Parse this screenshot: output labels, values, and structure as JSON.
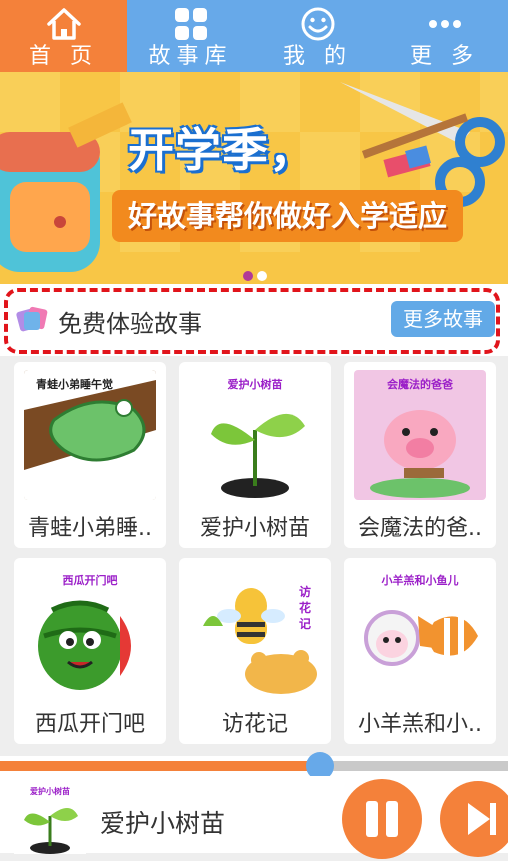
{
  "nav": {
    "items": [
      {
        "label": "首 页",
        "icon": "home-icon",
        "active": true
      },
      {
        "label": "故事库",
        "icon": "grid-icon",
        "active": false
      },
      {
        "label": "我 的",
        "icon": "smiley-icon",
        "active": false
      },
      {
        "label": "更 多",
        "icon": "more-dots-icon",
        "active": false
      }
    ]
  },
  "banner": {
    "title": "开学季，",
    "subtitle": "好故事帮你做好入学适应",
    "dots_total": 2,
    "dots_active_index": 0
  },
  "section": {
    "title": "免费体验故事",
    "more_label": "更多故事"
  },
  "stories": [
    {
      "title": "青蛙小弟睡..",
      "cover_caption": "青蛙小弟睡午觉"
    },
    {
      "title": "爱护小树苗",
      "cover_caption": "爱护小树苗"
    },
    {
      "title": "会魔法的爸..",
      "cover_caption": "会魔法的爸爸"
    },
    {
      "title": "西瓜开门吧",
      "cover_caption": "西瓜开门吧"
    },
    {
      "title": "访花记",
      "cover_caption": "访花记"
    },
    {
      "title": "小羊羔和小..",
      "cover_caption": "小羊羔和小鱼儿"
    }
  ],
  "player": {
    "title": "爱护小树苗",
    "thumb_caption": "爱护小树苗",
    "progress": 0.63
  },
  "colors": {
    "accent_orange": "#f4813a",
    "nav_blue": "#67a9e9",
    "highlight_red": "#e1141b"
  }
}
